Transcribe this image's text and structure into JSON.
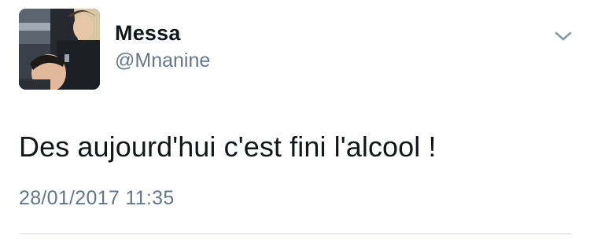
{
  "tweet": {
    "display_name": "Messa",
    "handle": "@Mnanine",
    "text": "Des aujourd'hui c'est fini l'alcool !",
    "timestamp": "28/01/2017 11:35"
  },
  "icons": {
    "menu": "chevron-down-icon",
    "avatar": "profile-photo"
  },
  "colors": {
    "primary_text": "#14171a",
    "secondary_text": "#657786",
    "divider": "#d5dbe0"
  }
}
